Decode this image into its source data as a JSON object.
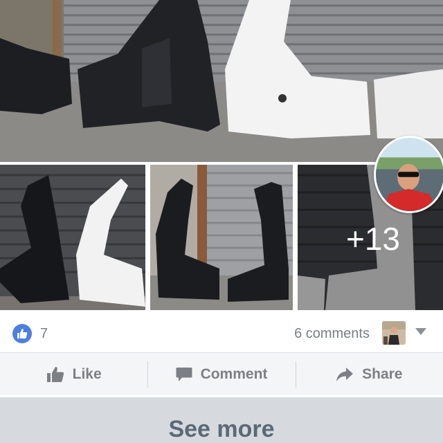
{
  "post": {
    "photos": {
      "more_count_label": "+13"
    },
    "reactions": {
      "like_count": "7",
      "comments_label": "6 comments"
    },
    "actions": {
      "like_label": "Like",
      "comment_label": "Comment",
      "share_label": "Share"
    },
    "see_more_label": "See more"
  },
  "colors": {
    "like_blue": "#4c7fe0",
    "action_gray": "#7c7f85",
    "see_more_bg": "#d6dade"
  },
  "icons": {
    "like_badge": "thumbs-up-icon",
    "like_action": "thumbs-up-icon",
    "comment_action": "speech-bubble-icon",
    "share_action": "share-arrow-icon",
    "dropdown": "chevron-down-icon"
  }
}
